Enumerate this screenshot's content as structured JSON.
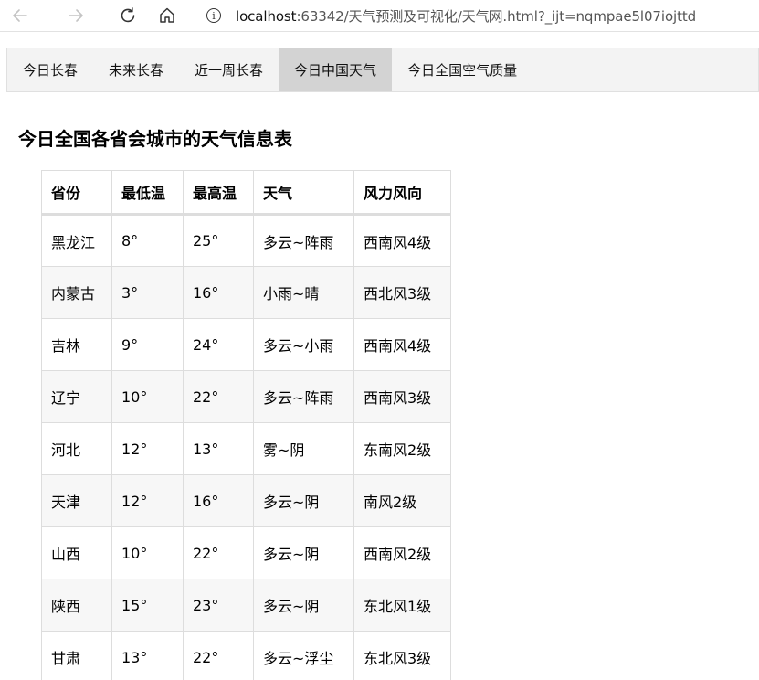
{
  "browser": {
    "url_host": "localhost",
    "url_rest": ":63342/天气预测及可视化/天气网.html?_ijt=nqmpae5l07iojttd",
    "info_glyph": "i",
    "icons": [
      "back-arrow-icon",
      "forward-arrow-icon",
      "reload-icon",
      "home-icon",
      "info-icon"
    ]
  },
  "nav": {
    "items": [
      {
        "label": "今日长春"
      },
      {
        "label": "未来长春"
      },
      {
        "label": "近一周长春"
      },
      {
        "label": "今日中国天气"
      },
      {
        "label": "今日全国空气质量"
      }
    ],
    "active_index": 3,
    "active_color": "#d3d3d3",
    "bar_color": "#f3f3f3"
  },
  "page": {
    "title": "今日全国各省会城市的天气信息表"
  },
  "table": {
    "headers": [
      "省份",
      "最低温",
      "最高温",
      "天气",
      "风力风向"
    ],
    "rows": [
      [
        "黑龙江",
        "8°",
        "25°",
        "多云~阵雨",
        "西南风4级"
      ],
      [
        "内蒙古",
        "3°",
        "16°",
        "小雨~晴",
        "西北风3级"
      ],
      [
        "吉林",
        "9°",
        "24°",
        "多云~小雨",
        "西南风4级"
      ],
      [
        "辽宁",
        "10°",
        "22°",
        "多云~阵雨",
        "西南风3级"
      ],
      [
        "河北",
        "12°",
        "13°",
        "雾~阴",
        "东南风2级"
      ],
      [
        "天津",
        "12°",
        "16°",
        "多云~阴",
        "南风2级"
      ],
      [
        "山西",
        "10°",
        "22°",
        "多云~阴",
        "西南风2级"
      ],
      [
        "陕西",
        "15°",
        "23°",
        "多云~阴",
        "东北风1级"
      ],
      [
        "甘肃",
        "13°",
        "22°",
        "多云~浮尘",
        "东北风3级"
      ]
    ]
  }
}
